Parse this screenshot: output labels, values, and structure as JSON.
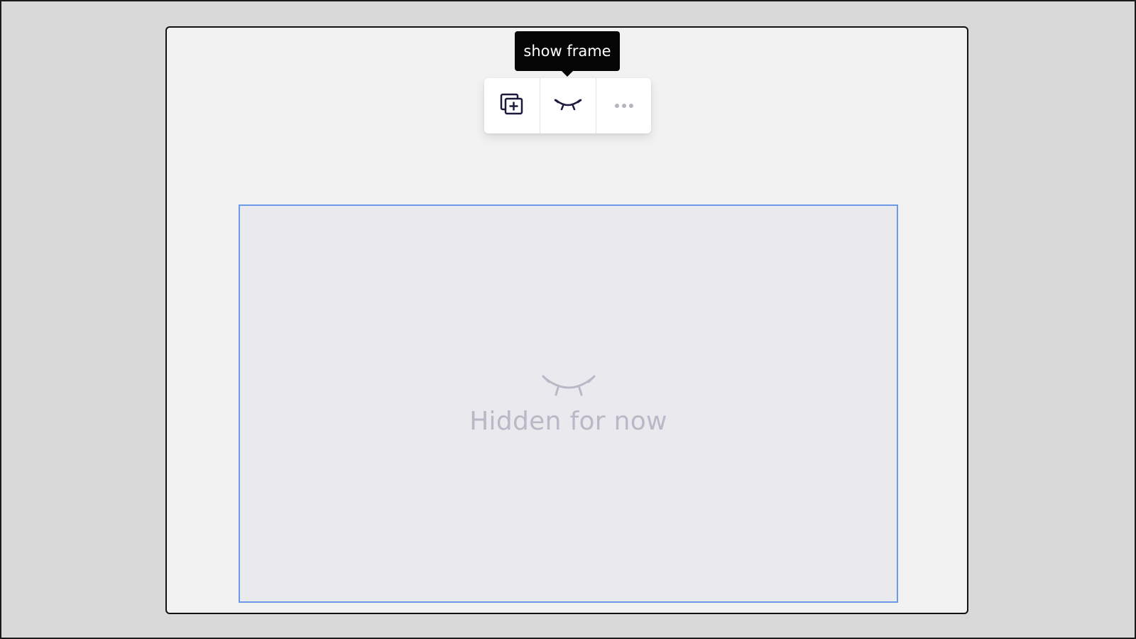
{
  "tooltip": {
    "text": "show frame"
  },
  "toolbar": {
    "buttons": [
      {
        "icon": "add-frame-icon"
      },
      {
        "icon": "eye-closed-icon"
      },
      {
        "icon": "more-icon"
      }
    ]
  },
  "frame": {
    "placeholder_icon": "eye-closed-icon",
    "placeholder_text": "Hidden for now"
  },
  "colors": {
    "background": "#d9d9d9",
    "canvas": "#f2f2f2",
    "frame_fill": "#eaeaee",
    "frame_border": "#6b9be8",
    "icon_dark": "#1c1a3a",
    "placeholder_text": "#b8b8c6",
    "tooltip_bg": "#050505"
  }
}
